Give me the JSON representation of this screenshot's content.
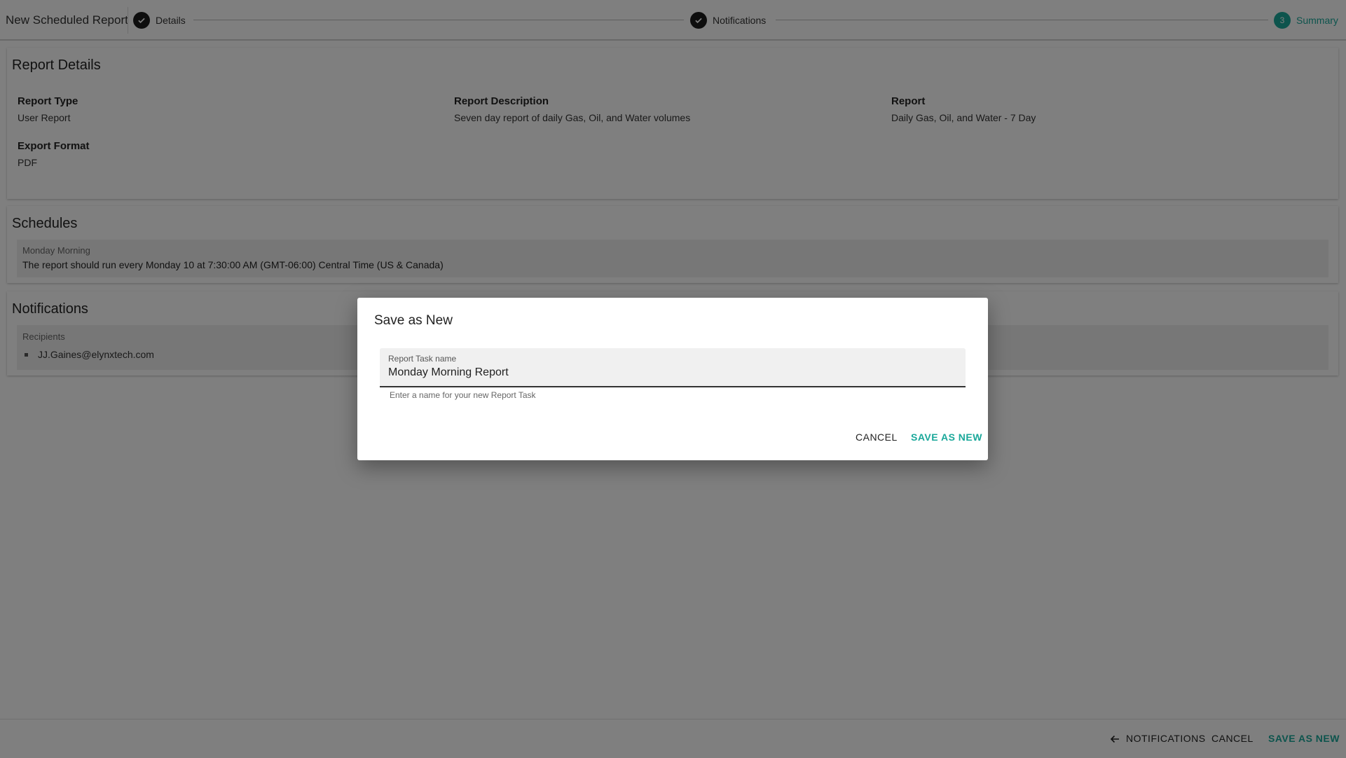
{
  "header": {
    "title": "New Scheduled Report",
    "steps": [
      {
        "label": "Details",
        "state": "complete",
        "icon": "check-icon"
      },
      {
        "label": "Notifications",
        "state": "complete",
        "icon": "check-icon"
      },
      {
        "label": "Summary",
        "number": "3",
        "state": "active"
      }
    ]
  },
  "details": {
    "title": "Report Details",
    "report_type_label": "Report Type",
    "report_type_value": "User Report",
    "description_label": "Report Description",
    "description_value": "Seven day report of daily Gas, Oil, and Water volumes",
    "report_label": "Report",
    "report_value": "Daily Gas, Oil, and Water - 7 Day",
    "export_label": "Export Format",
    "export_value": "PDF"
  },
  "schedules": {
    "title": "Schedules",
    "items": [
      {
        "name": "Monday Morning",
        "description": "The report should run every Monday 10 at 7:30:00 AM (GMT-06:00) Central Time (US & Canada)"
      }
    ]
  },
  "notifications": {
    "title": "Notifications",
    "recipients_label": "Recipients",
    "recipients": [
      "JJ.Gaines@elynxtech.com"
    ]
  },
  "footer": {
    "back_label": "NOTIFICATIONS",
    "cancel_label": "CANCEL",
    "save_label": "SAVE AS NEW"
  },
  "dialog": {
    "title": "Save as New",
    "field_label": "Report Task name",
    "field_value": "Monday Morning Report",
    "field_hint": "Enter a name for your new Report Task",
    "cancel_label": "CANCEL",
    "save_label": "SAVE AS NEW"
  },
  "colors": {
    "accent": "#1aa89a",
    "step_complete": "#1c1c1c",
    "overlay": "rgba(0,0,0,0.5)"
  }
}
